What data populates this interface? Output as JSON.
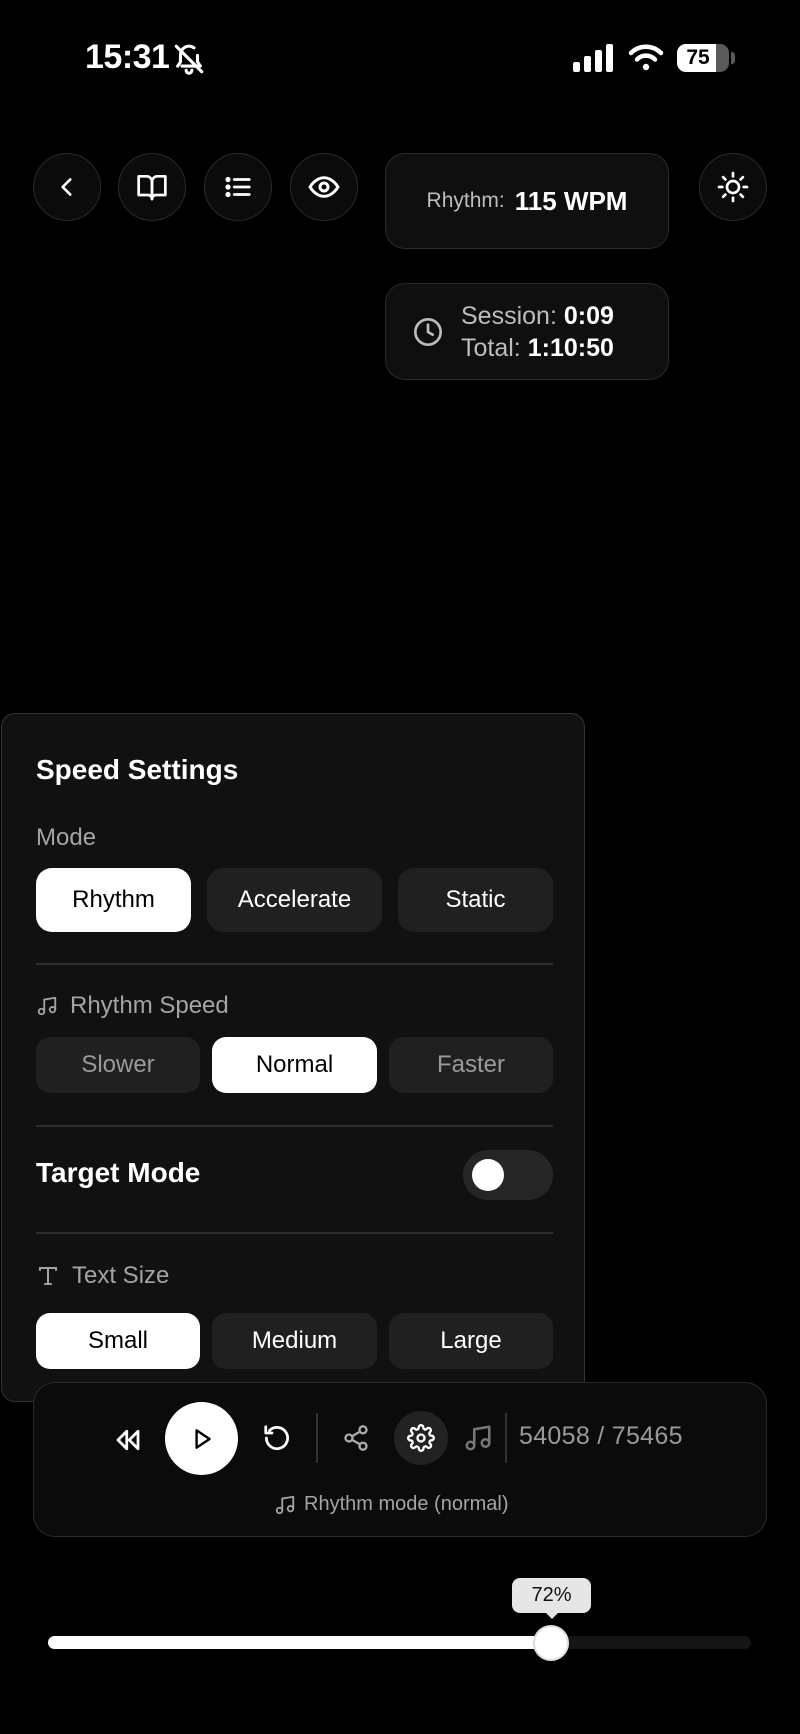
{
  "status_bar": {
    "time": "15:31",
    "battery": "75",
    "icons": [
      "bell-slash-icon",
      "signal-icon",
      "wifi-icon",
      "battery-icon"
    ]
  },
  "toolbar": {
    "buttons": [
      "back-icon",
      "book-icon",
      "list-icon",
      "eye-icon",
      "sun-icon"
    ]
  },
  "rhythm_card": {
    "label": "Rhythm:",
    "value": "115 WPM"
  },
  "time_card": {
    "session_label": "Session:",
    "session_value": "0:09",
    "total_label": "Total:",
    "total_value": "1:10:50"
  },
  "speed_settings": {
    "title": "Speed Settings",
    "mode_label": "Mode",
    "modes": [
      "Rhythm",
      "Accelerate",
      "Static"
    ],
    "selected_mode": "Rhythm",
    "rhythm_speed_label": "Rhythm Speed",
    "rhythm_speeds": [
      "Slower",
      "Normal",
      "Faster"
    ],
    "selected_rhythm_speed": "Normal",
    "target_mode_label": "Target Mode",
    "target_mode_on": false,
    "text_size_label": "Text Size",
    "text_sizes": [
      "Small",
      "Medium",
      "Large"
    ],
    "selected_text_size": "Small"
  },
  "player": {
    "position": "54058 / 75465",
    "mode_text": "Rhythm mode (normal)"
  },
  "progress": {
    "label": "72%",
    "value": 0.72
  },
  "colors": {
    "background": "#000000",
    "card": "#0f0f0f",
    "active": "#ffffff"
  }
}
